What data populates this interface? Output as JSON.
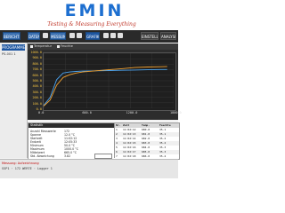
{
  "brand": {
    "title": "EMIN",
    "subtitle": "Testing & Measuring Everything"
  },
  "toolbar": {
    "buttons": [
      "BERICHTE",
      "DATEN",
      "MESSUNG",
      "GRAFIK"
    ],
    "right_buttons": [
      "EINSTELLUNG",
      "ANALYSE"
    ]
  },
  "sidebar": {
    "header": "PROGRAMME",
    "sub": "PS-001 1"
  },
  "chart": {
    "tabs": [
      "Temperatur",
      "Feuchte"
    ],
    "colors": {
      "series1": "#4aa3f0",
      "series2": "#f0a030"
    }
  },
  "chart_data": {
    "type": "line",
    "y_ticks": [
      "1000.0",
      "900.0",
      "800.0",
      "700.0",
      "600.0",
      "500.0",
      "400.0",
      "300.0",
      "200.0",
      "100.0",
      "0.0"
    ],
    "x_ticks": [
      "0.0",
      "600.0",
      "1200.0",
      "1800.0"
    ],
    "x": [
      0,
      100,
      200,
      300,
      400,
      500,
      600,
      800,
      1000,
      1200,
      1400,
      1600,
      1800,
      1900
    ],
    "series": [
      {
        "values": [
          50,
          200,
          520,
          640,
          660,
          670,
          675,
          680,
          685,
          690,
          695,
          700,
          705,
          705
        ]
      },
      {
        "values": [
          40,
          150,
          420,
          560,
          610,
          640,
          660,
          680,
          700,
          720,
          740,
          750,
          755,
          760
        ]
      }
    ],
    "ylim": [
      0,
      1000
    ],
    "xlim": [
      0,
      2000
    ],
    "grid": true
  },
  "stats": {
    "header": "Statistik",
    "left_labels": [
      "Anzahl Messwerte",
      "Spanne",
      "Startzeit",
      "Endzeit",
      "Minimum",
      "Maximum",
      "Mittelwert",
      "Std. Abweichung"
    ],
    "left_values": [
      "172",
      "12.0 °C",
      "11:02:12",
      "12:05:33",
      "50.0 °C",
      "1000.0 °C",
      "665.0 °C",
      "3.82"
    ]
  },
  "table": {
    "columns": [
      "Nr.",
      "Zeit",
      "Temp.",
      "Feuchte"
    ],
    "rows": [
      [
        "1",
        "11:02:12",
        "680.0",
        "35.1"
      ],
      [
        "2",
        "11:02:13",
        "681.0",
        "35.1"
      ],
      [
        "3",
        "11:02:14",
        "682.0",
        "35.2"
      ],
      [
        "4",
        "11:02:15",
        "683.0",
        "35.2"
      ],
      [
        "5",
        "11:02:16",
        "684.0",
        "35.3"
      ],
      [
        "6",
        "11:02:17",
        "685.0",
        "35.3"
      ],
      [
        "7",
        "11:02:18",
        "686.0",
        "35.4"
      ]
    ]
  },
  "status": {
    "red_text": "Messung: Aufzeichnung",
    "gray_text": "SSP1 · 172 WERTE · Logger 1"
  }
}
